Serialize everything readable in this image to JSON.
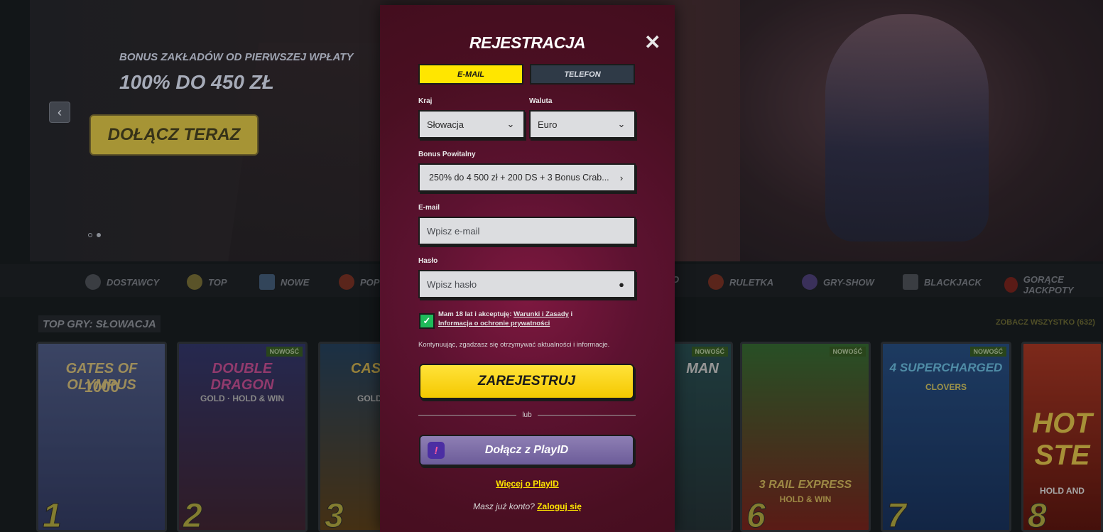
{
  "hero": {
    "subtitle": "BONUS ZAKŁADÓW OD PIERWSZEJ WPŁATY",
    "headline": "100% DO 450 ZŁ",
    "cta": "DOŁĄCZ TERAZ",
    "prev_icon": "chevron-left-icon"
  },
  "categories": [
    {
      "label": "DOSTAWCY",
      "icon": "providers-icon"
    },
    {
      "label": "TOP",
      "icon": "star-icon"
    },
    {
      "label": "NOWE",
      "icon": "new-icon"
    },
    {
      "label": "POP",
      "icon": "popular-icon"
    },
    {
      "label": "O",
      "icon": "partial-icon"
    },
    {
      "label": "RULETKA",
      "icon": "roulette-icon"
    },
    {
      "label": "GRY-SHOW",
      "icon": "gameshow-icon"
    },
    {
      "label": "BLACKJACK",
      "icon": "cards-icon"
    },
    {
      "label": "GORĄCE JACKPOTY",
      "icon": "chili-icon"
    }
  ],
  "games_section": {
    "title": "TOP GRY: SŁOWACJA",
    "see_all": "ZOBACZ WSZYSTKO (632)",
    "badge": "NOWOŚĆ",
    "tiles": [
      {
        "rank": "1",
        "name": "GATES OF OLYMPUS",
        "sub": "1000",
        "color": "#4a5a86",
        "new": false
      },
      {
        "rank": "2",
        "name": "DOUBLE DRAGON",
        "sub": "GOLD · HOLD & WIN",
        "color": "#3a3f7a",
        "new": true
      },
      {
        "rank": "3",
        "name": "CASH CO",
        "sub": "GOLD BOOK",
        "color": "#4a3a1f",
        "new": false
      },
      {
        "rank": "",
        "name": "MAN",
        "sub": "",
        "color": "#2f4a4e",
        "new": true
      },
      {
        "rank": "6",
        "name": "3 RAIL EXPRESS",
        "sub": "HOLD & WIN",
        "color": "#3d6b3a",
        "new": true
      },
      {
        "rank": "7",
        "name": "4 SUPERCHARGED",
        "sub": "CLOVERS",
        "color": "#2d5a95",
        "new": true
      },
      {
        "rank": "8",
        "name": "HOT STE",
        "sub": "HOLD AND",
        "color": "#8a2a1f",
        "new": false
      }
    ]
  },
  "modal": {
    "title": "REJESTRACJA",
    "close_icon": "close-icon",
    "tabs": {
      "email": "E-MAIL",
      "phone": "TELEFON"
    },
    "country_label": "Kraj",
    "country_value": "Słowacja",
    "currency_label": "Waluta",
    "currency_value": "Euro",
    "bonus_label": "Bonus Powitalny",
    "bonus_value": "250% do 4 500 zł + 200 DS + 3 Bonus Crab...",
    "email_label": "E-mail",
    "email_placeholder": "Wpisz e-mail",
    "password_label": "Hasło",
    "password_placeholder": "Wpisz hasło",
    "consent_prefix": "Mam 18 lat i akceptuję: ",
    "terms_link": "Warunki i Zasady",
    "consent_and": " i ",
    "privacy_link": "Informacja o ochronie prywatności",
    "info": "Kontynuując, zgadzasz się otrzymywać aktualności i informacje.",
    "submit": "ZAREJESTRUJ",
    "or": "lub",
    "playid_button": "Dołącz z PlayID",
    "playid_more": "Więcej o PlayID",
    "login_prompt": "Masz już konto?",
    "login_link": "Zaloguj się"
  },
  "colors": {
    "accent_yellow": "#ffe600",
    "modal_bg": "#5c1230",
    "checkbox_green": "#1fbb5a",
    "playid_purple": "#7a6aa8"
  }
}
